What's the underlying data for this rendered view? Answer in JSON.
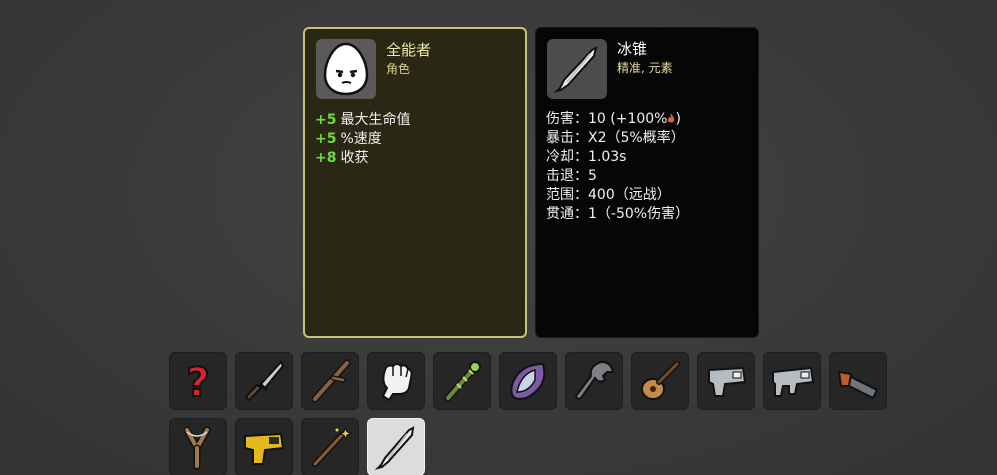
{
  "character": {
    "name": "全能者",
    "type": "角色",
    "icon": "egg-face-icon",
    "stats": [
      {
        "value": "+5",
        "label": "最大生命值"
      },
      {
        "value": "+5",
        "label": "%速度"
      },
      {
        "value": "+8",
        "label": "收获"
      }
    ]
  },
  "weapon": {
    "name": "冰锥",
    "tags": "精准, 元素",
    "icon": "icicle-icon",
    "stats": [
      {
        "key": "伤害",
        "value": "10 (+100%",
        "suffix": ")"
      },
      {
        "key": "暴击",
        "value": "X2（5%概率）"
      },
      {
        "key": "冷却",
        "value": "1.03s"
      },
      {
        "key": "击退",
        "value": "5"
      },
      {
        "key": "范围",
        "value": "400（远战）"
      },
      {
        "key": "贯通",
        "value": "1（-50%伤害）"
      }
    ]
  },
  "colors": {
    "positive": "#6bdc3a",
    "char_border": "#c9c179",
    "char_bg": "#2a2814",
    "weapon_bg": "#060606"
  },
  "weapon_slots": [
    "random-question-icon",
    "knife-icon",
    "stick-icon",
    "fist-icon",
    "thorny-club-icon",
    "crystal-leaf-icon",
    "wrench-icon",
    "lute-icon",
    "blaster-gun-icon",
    "smg-gun-icon",
    "double-barrel-icon",
    "slingshot-icon",
    "taser-icon",
    "magic-wand-icon",
    "icicle-icon"
  ],
  "selected_slot": "icicle-icon"
}
